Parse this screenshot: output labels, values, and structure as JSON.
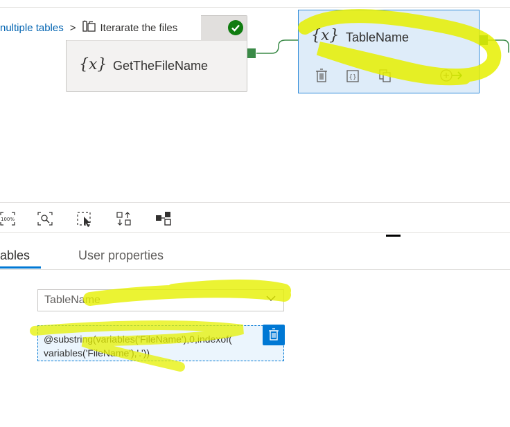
{
  "breadcrumb": {
    "parent": "nultiple tables",
    "separator": ">",
    "current": "Iterarate the files"
  },
  "canvas": {
    "node1": {
      "label": "GetTheFileName",
      "icon": "variable-icon",
      "glyph": "{x}",
      "status": "succeeded"
    },
    "node2": {
      "label": "TableName",
      "icon": "variable-icon",
      "glyph": "{x}",
      "selected": true
    }
  },
  "toolbar": {
    "zoom_label": "100%"
  },
  "tabs": {
    "active": "ables",
    "inactive": "User properties"
  },
  "form": {
    "variable_select_value": "TableName",
    "expression": "@substring(variables('FileName'),0,indexof( variables('FileName'),'.'))"
  },
  "colors": {
    "accent": "#0078d4",
    "success": "#107c10",
    "port": "#3a8a47",
    "highlight": "#e6f000"
  }
}
